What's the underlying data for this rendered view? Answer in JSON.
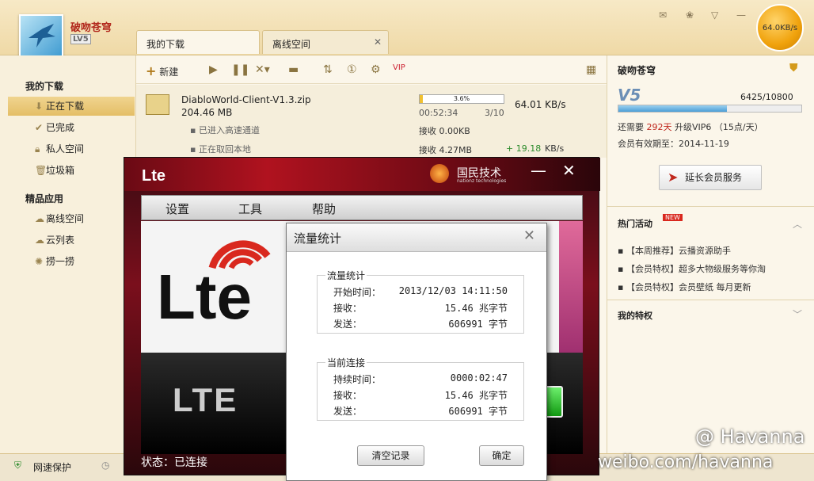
{
  "thunder": {
    "username": "破吻苍穹",
    "level": "LV5",
    "speed": "64.0KB/s",
    "tabs": [
      {
        "label": "我的下载"
      },
      {
        "label": "离线空间"
      }
    ],
    "sidebar": {
      "header1": "我的下载",
      "items1": [
        {
          "label": "正在下载"
        },
        {
          "label": "已完成"
        },
        {
          "label": "私人空间"
        },
        {
          "label": "垃圾箱"
        }
      ],
      "header2": "精品应用",
      "items2": [
        {
          "label": "离线空间"
        },
        {
          "label": "云列表"
        },
        {
          "label": "捞一捞"
        }
      ]
    },
    "toolbar": {
      "new_label": "新建"
    },
    "download": {
      "filename": "DiabloWorld-Client-V1.3.zip",
      "size": "204.46 MB",
      "progress_text": "3.6%",
      "progress": 0.036,
      "time": "00:52:34",
      "parts": "3/10",
      "speed": "64.01 KB/s",
      "sub1": "已进入高速通道",
      "sub1_recv": "接收 0.00KB",
      "sub2": "正在取回本地",
      "sub2_recv": "接收 4.27MB",
      "sub2_plus": "+ 19.18",
      "sub2_speed": "KB/s"
    },
    "right": {
      "name": "破吻苍穹",
      "vip_label": "V5",
      "vip_points": "6425/10800",
      "vip_progress": 0.595,
      "need_prefix": "还需要",
      "need_days": "292天",
      "need_suffix": "升级VIP6 （15点/天）",
      "valid": "会员有效期至：2014-11-19",
      "extend_btn": "延长会员服务",
      "hot_title": "热门活动",
      "new_badge": "NEW",
      "hot_items": [
        {
          "label": "【本周推荐】云播资源助手"
        },
        {
          "label": "【会员特权】超多大物级服务等你淘"
        },
        {
          "label": "【会员特权】会员壁纸 每月更新"
        }
      ],
      "priv_title": "我的特权"
    },
    "status": {
      "protect": "网速保护"
    }
  },
  "lte": {
    "logo": "Lte",
    "brand": "国民技术",
    "brand_sub": "nationz technologies",
    "menu": [
      {
        "label": "设置"
      },
      {
        "label": "工具"
      },
      {
        "label": "帮助"
      }
    ],
    "big_logo": "Lte",
    "lower_text": "LTE",
    "status": "状态：已连接"
  },
  "dialog": {
    "title": "流量统计",
    "group1": {
      "title": "流量统计",
      "rows": [
        {
          "k": "开始时间：",
          "v": "2013/12/03 14:11:50"
        },
        {
          "k": "接收：",
          "v": "15.46 兆字节"
        },
        {
          "k": "发送：",
          "v": "606991 字节"
        }
      ]
    },
    "group2": {
      "title": "当前连接",
      "rows": [
        {
          "k": "持续时间：",
          "v": "0000:02:47"
        },
        {
          "k": "接收：",
          "v": "15.46 兆字节"
        },
        {
          "k": "发送：",
          "v": "606991 字节"
        }
      ]
    },
    "clear_btn": "清空记录",
    "ok_btn": "确定"
  },
  "watermark": {
    "line1": "@ Havanna",
    "line2": "weibo.com/havanna"
  }
}
